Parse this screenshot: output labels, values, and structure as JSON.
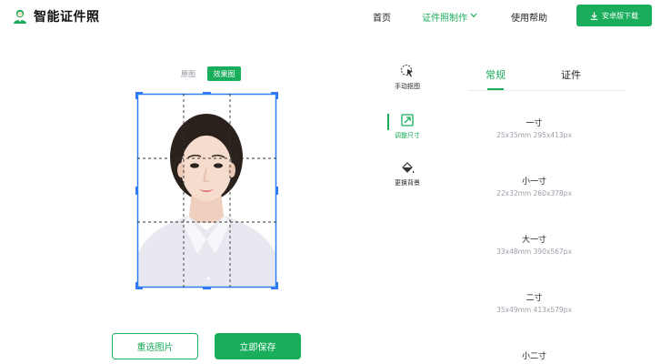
{
  "header": {
    "app_name": "智能证件照",
    "nav": {
      "home": "首页",
      "make": "证件照制作",
      "help": "使用帮助"
    },
    "download_label": "安卓版下载"
  },
  "view_toggle": {
    "original": "原图",
    "result": "效果图"
  },
  "actions": {
    "reselect": "重选图片",
    "save": "立即保存"
  },
  "tools": [
    {
      "label": "手动抠图",
      "icon": "cursor-select-icon"
    },
    {
      "label": "调整尺寸",
      "icon": "resize-icon",
      "active": true
    },
    {
      "label": "更换背景",
      "icon": "paint-bucket-icon"
    }
  ],
  "tabs": [
    {
      "label": "常规",
      "active": true
    },
    {
      "label": "证件"
    }
  ],
  "sizes": [
    {
      "name": "一寸",
      "dims": "25x35mm 295x413px"
    },
    {
      "name": "小一寸",
      "dims": "22x32mm 260x378px"
    },
    {
      "name": "大一寸",
      "dims": "33x48mm 390x567px"
    },
    {
      "name": "二寸",
      "dims": "35x49mm 413x579px"
    },
    {
      "name": "小二寸",
      "dims": ""
    }
  ],
  "colors": {
    "accent": "#1aad5b",
    "muted_text": "#9aa0a8",
    "selection": "#2f7cf6"
  }
}
